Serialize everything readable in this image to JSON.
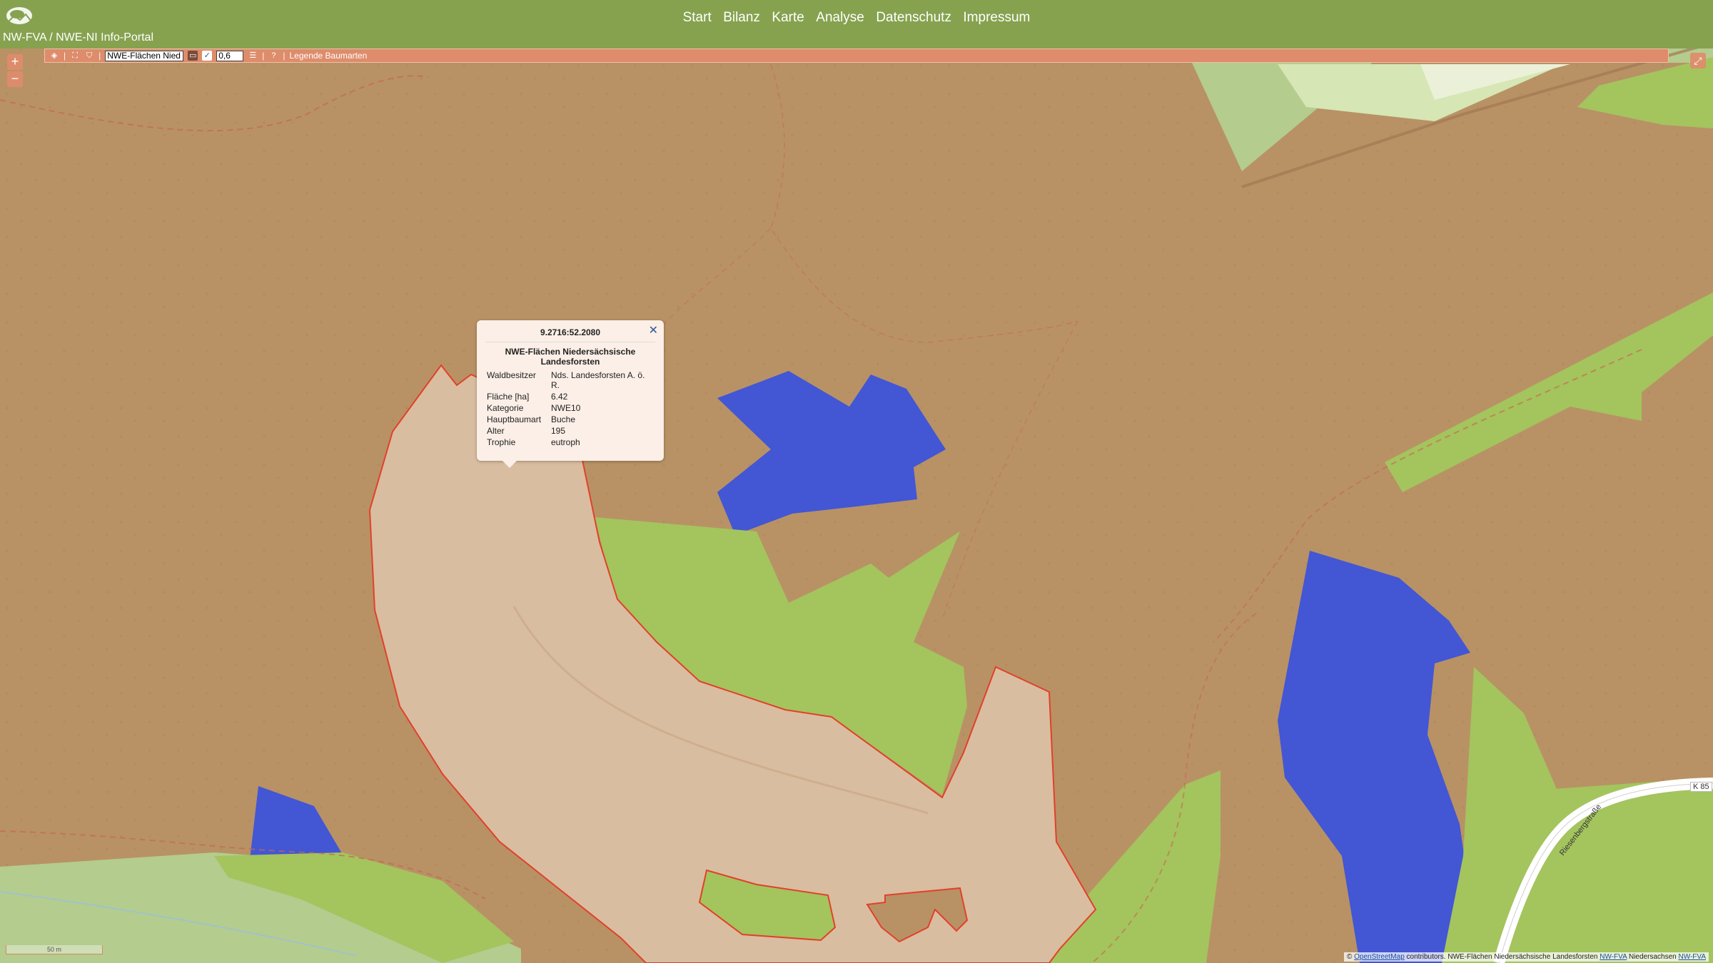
{
  "header": {
    "nav": [
      "Start",
      "Bilanz",
      "Karte",
      "Analyse",
      "Datenschutz",
      "Impressum"
    ],
    "portal_title": "NW-FVA / NWE-NI Info-Portal"
  },
  "toolbar": {
    "layer_value": "NWE-Flächen Nied",
    "opacity_value": "0,6",
    "legend_label": "Legende Baumarten",
    "buttons": [
      "layers-icon",
      "separator",
      "fullextent-icon",
      "info-icon"
    ]
  },
  "zoom": {
    "in": "+",
    "out": "−"
  },
  "popup": {
    "coord": "9.2716:52.2080",
    "title": "NWE-Flächen Niedersächsische Landesforsten",
    "rows": [
      {
        "key": "Waldbesitzer",
        "value": "Nds. Landesforsten A. ö. R."
      },
      {
        "key": "Fläche [ha]",
        "value": "6.42"
      },
      {
        "key": "Kategorie",
        "value": "NWE10"
      },
      {
        "key": "Hauptbaumart",
        "value": "Buche"
      },
      {
        "key": "Alter",
        "value": "195"
      },
      {
        "key": "Trophie",
        "value": "eutroph"
      }
    ],
    "close": "✕"
  },
  "map_labels": {
    "k85": "K 85",
    "riesenbergstrasse": "Riesenbergstraße",
    "scale": "50 m"
  },
  "attribution": {
    "copy": "©",
    "osm": "OpenStreetMap",
    "text1": "contributors. NWE-Flächen Niedersächsische Landesforsten",
    "nwfva1": "NW-FVA",
    "text2": "Niedersachsen",
    "nwfva2": "NW-FVA"
  },
  "colors": {
    "header": "#86a24f",
    "toolbar": "#de8c6b",
    "forest_brown": "#b89265",
    "green": "#a4c45e",
    "blue": "#4356d4",
    "highlight_area": "#d9bda0",
    "highlight_border": "#e2402a"
  }
}
